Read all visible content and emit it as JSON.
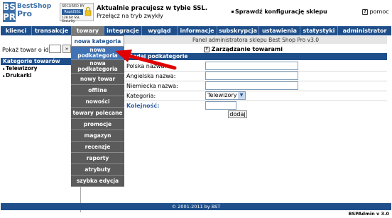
{
  "header": {
    "logo": {
      "bs": "BS\nPRO",
      "shop": "BestShop",
      "pro": "Pro"
    },
    "ssl_badge": {
      "line1": "SECURED BY",
      "line2": "RapidSSL",
      "line3": "128 bit SSL Security"
    },
    "ssl_title": "Aktualnie pracujesz w tybie SSL.",
    "ssl_switch": "Przełącz na tryb zwykły",
    "check_config": "Sprawdź konfigurację sklepu",
    "help": "pomoc"
  },
  "nav": {
    "items": [
      {
        "label": "klienci"
      },
      {
        "label": "transakcje"
      },
      {
        "label": "towary"
      },
      {
        "label": "integracje"
      },
      {
        "label": "wygląd"
      },
      {
        "label": "informacje"
      },
      {
        "label": "subskrypcja"
      },
      {
        "label": "ustawienia"
      },
      {
        "label": "statystyki"
      },
      {
        "label": "administrator"
      }
    ],
    "active": "towary"
  },
  "subbar": "Panel administratora sklepu Best Shop Pro v3.0",
  "left": {
    "goto_label": "Pokaż towar o id:",
    "goto_value": "",
    "goto_btn": "»",
    "categories_title": "Kategorie towarów",
    "categories": [
      {
        "label": "Telewizory"
      },
      {
        "label": "Drukarki"
      }
    ]
  },
  "dropdown": {
    "items": [
      {
        "label": "nowa kategoria"
      },
      {
        "label": "nowa podkategoria"
      },
      {
        "label": "nowa podkategoria"
      },
      {
        "label": "nowy towar"
      },
      {
        "label": "offline"
      },
      {
        "label": "nowości"
      },
      {
        "label": "towary polecane"
      },
      {
        "label": "promocje"
      },
      {
        "label": "magazyn"
      },
      {
        "label": "recenzje"
      },
      {
        "label": "raporty"
      },
      {
        "label": "atrybuty"
      },
      {
        "label": "szybka edycja"
      }
    ],
    "highlighted_index": 1
  },
  "manage": "Zarządzanie towarami",
  "form": {
    "title": "Dodaj podkategorie",
    "fields": {
      "polish_name": {
        "label": "Polska nazwa:",
        "value": ""
      },
      "english_name": {
        "label": "Angielska nazwa:",
        "value": ""
      },
      "german_name": {
        "label": "Niemiecka nazwa:",
        "value": ""
      },
      "category": {
        "label": "Kategoria:",
        "value": "Telewizory"
      },
      "order": {
        "label": "Kolejność:",
        "value": ""
      }
    },
    "submit": "dodaj"
  },
  "footer": "© 2001-2011 by BST",
  "version": "BSPAdmin v 3.0",
  "colors": {
    "nav": "#1f4f8b",
    "dropdown": "#5b5b5b",
    "highlight": "#3f73b5",
    "arrow": "#e00000"
  }
}
